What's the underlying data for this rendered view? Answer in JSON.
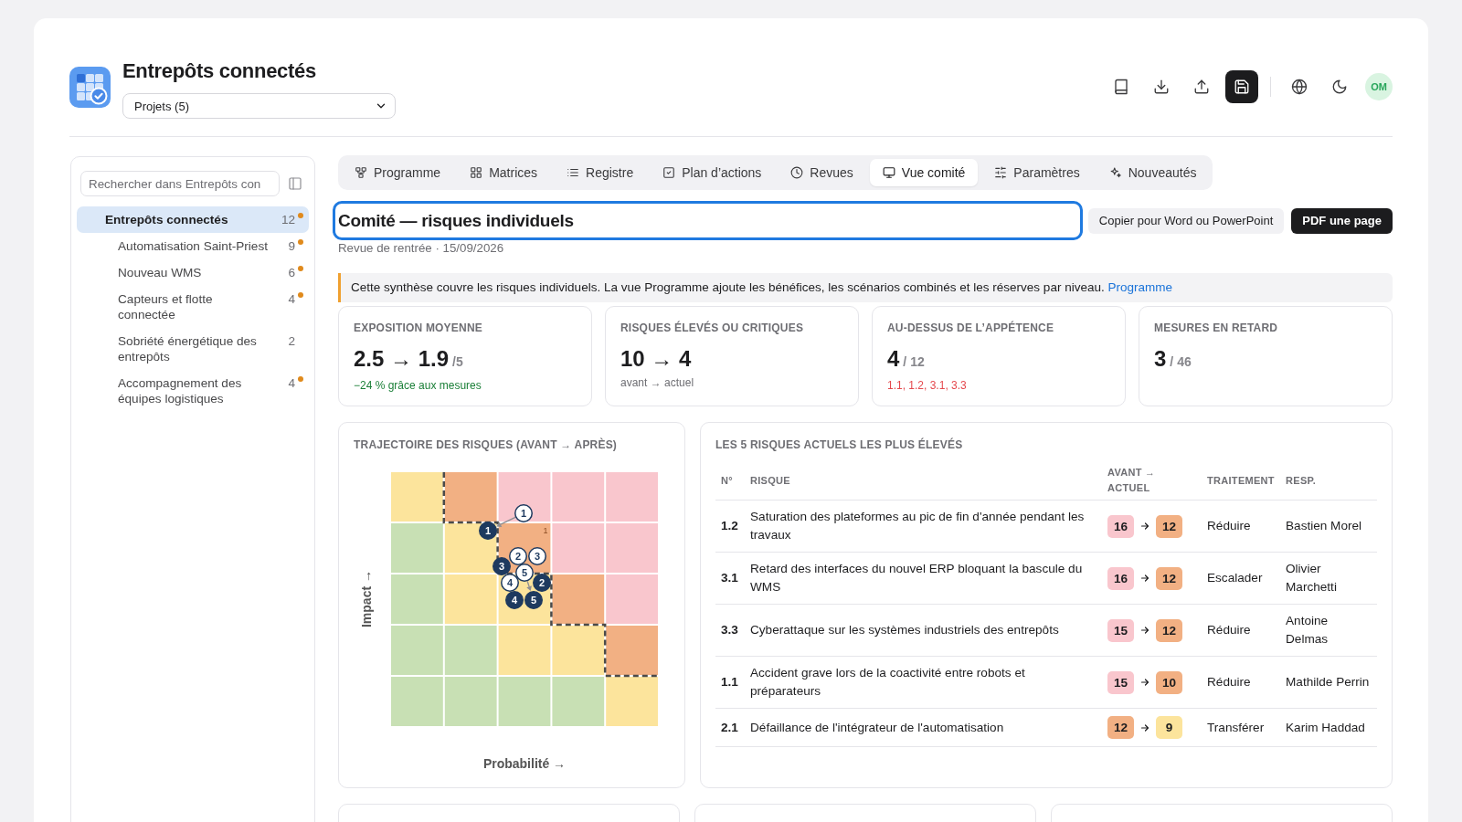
{
  "header": {
    "title": "Entrepôts connectés",
    "project_select": {
      "value": "Projets (5)"
    },
    "avatar": {
      "initials": "OM"
    }
  },
  "sidebar": {
    "search": {
      "placeholder": "Rechercher dans Entrepôts con"
    },
    "tree": [
      {
        "label": "Entrepôts connectés",
        "count": "12",
        "flagged": true,
        "selected": true,
        "children": [
          {
            "label": "Automatisation Saint-Priest",
            "count": "9",
            "flagged": true,
            "selected": false
          },
          {
            "label": "Nouveau WMS",
            "count": "6",
            "flagged": true,
            "selected": false
          },
          {
            "label": "Capteurs et flotte connectée",
            "count": "4",
            "flagged": true,
            "selected": false
          },
          {
            "label": "Sobriété énergétique des entrepôts",
            "count": "2",
            "flagged": false,
            "selected": false
          },
          {
            "label": "Accompagnement des équipes logistiques",
            "count": "4",
            "flagged": true,
            "selected": false
          }
        ]
      }
    ]
  },
  "tabs": [
    {
      "label": "Programme",
      "kind": "hierarchy",
      "selected": false
    },
    {
      "label": "Matrices",
      "kind": "grid",
      "selected": false
    },
    {
      "label": "Registre",
      "kind": "list",
      "selected": false
    },
    {
      "label": "Plan d’actions",
      "kind": "checklist",
      "selected": false
    },
    {
      "label": "Revues",
      "kind": "clock",
      "selected": false
    },
    {
      "label": "Vue comité",
      "kind": "monitor",
      "selected": true
    },
    {
      "label": "Paramètres",
      "kind": "sliders",
      "selected": false
    },
    {
      "label": "Nouveautés",
      "kind": "sparkles",
      "selected": false
    }
  ],
  "committee": {
    "title_field": {
      "value": "Comité — risques individuels"
    },
    "actions": [
      {
        "label": "Copier pour Word ou PowerPoint",
        "kind": "secondary"
      },
      {
        "label": "PDF une page",
        "kind": "primary"
      }
    ],
    "subtitle": "Revue de rentrée · 15/09/2026"
  },
  "notice": {
    "text": "Cette synthèse couvre les risques individuels. La vue Programme ajoute les bénéfices, les scénarios combinés et les réserves par niveau.",
    "link": "Programme"
  },
  "kpis": [
    {
      "title": "EXPOSITION MOYENNE",
      "value": "2.5 → 1.9",
      "unit": "/5",
      "note": {
        "text": "−24 % grâce aux mesures",
        "color": "#1a7f37"
      }
    },
    {
      "title": "RISQUES ÉLEVÉS OU CRITIQUES",
      "value": "10 → 4",
      "note": {
        "text": "avant → actuel",
        "color": "#6e6e73"
      }
    },
    {
      "title": "AU-DESSUS DE L’APPÉTENCE",
      "value": "4",
      "unit": "/ 12",
      "note": {
        "text": "1.1, 1.2, 3.1, 3.3",
        "color": "#e5484d"
      }
    },
    {
      "title": "MESURES EN RETARD",
      "value": "3",
      "unit": "/ 46"
    }
  ],
  "trajectory": {
    "title": "TRAJECTOIRE DES RISQUES (AVANT → APRÈS)",
    "y_label": "Impact →",
    "x_label": "Probabilité →",
    "rows": [
      {
        "cells": [
          {
            "color": "#fce49c"
          },
          {
            "color": "#f2b083"
          },
          {
            "color": "#f9c6cd"
          },
          {
            "color": "#f9c6cd"
          },
          {
            "color": "#f9c6cd"
          }
        ]
      },
      {
        "cells": [
          {
            "color": "#c8e0b4"
          },
          {
            "color": "#fce49c"
          },
          {
            "color": "#f2b083",
            "note": "1"
          },
          {
            "color": "#f9c6cd"
          },
          {
            "color": "#f9c6cd"
          }
        ]
      },
      {
        "cells": [
          {
            "color": "#c8e0b4"
          },
          {
            "color": "#fce49c"
          },
          {
            "color": "#fce49c"
          },
          {
            "color": "#f2b083"
          },
          {
            "color": "#f9c6cd"
          }
        ]
      },
      {
        "cells": [
          {
            "color": "#c8e0b4"
          },
          {
            "color": "#c8e0b4"
          },
          {
            "color": "#fce49c"
          },
          {
            "color": "#fce49c"
          },
          {
            "color": "#f2b083"
          }
        ]
      },
      {
        "cells": [
          {
            "color": "#c8e0b4"
          },
          {
            "color": "#c8e0b4"
          },
          {
            "color": "#c8e0b4"
          },
          {
            "color": "#c8e0b4"
          },
          {
            "color": "#fce49c"
          }
        ]
      }
    ],
    "markers": [
      {
        "label": "1",
        "kind": "before"
      },
      {
        "label": "1",
        "kind": "after"
      },
      {
        "label": "2",
        "kind": "before"
      },
      {
        "label": "2",
        "kind": "after"
      },
      {
        "label": "3",
        "kind": "before"
      },
      {
        "label": "3",
        "kind": "after"
      },
      {
        "label": "4",
        "kind": "before"
      },
      {
        "label": "4",
        "kind": "after"
      },
      {
        "label": "5",
        "kind": "before"
      },
      {
        "label": "5",
        "kind": "after"
      }
    ]
  },
  "top_risks": {
    "title": "LES 5 RISQUES ACTUELS LES PLUS ÉLEVÉS",
    "columns": [
      "N°",
      "RISQUE",
      "AVANT → ACTUEL",
      "TRAITEMENT",
      "RESP."
    ],
    "rows": [
      {
        "id": "1.2",
        "risk": "Saturation des plateformes au pic de fin d'année pendant les travaux",
        "before": {
          "score": "16",
          "color": "#f9c6cd"
        },
        "after": {
          "score": "12",
          "color": "#f2b083"
        },
        "treatment": "Réduire",
        "owner": "Bastien Morel"
      },
      {
        "id": "3.1",
        "risk": "Retard des interfaces du nouvel ERP bloquant la bascule du WMS",
        "before": {
          "score": "16",
          "color": "#f9c6cd"
        },
        "after": {
          "score": "12",
          "color": "#f2b083"
        },
        "treatment": "Escalader",
        "owner": "Olivier Marchetti"
      },
      {
        "id": "3.3",
        "risk": "Cyberattaque sur les systèmes industriels des entrepôts",
        "before": {
          "score": "15",
          "color": "#f9c6cd"
        },
        "after": {
          "score": "12",
          "color": "#f2b083"
        },
        "treatment": "Réduire",
        "owner": "Antoine Delmas"
      },
      {
        "id": "1.1",
        "risk": "Accident grave lors de la coactivité entre robots et préparateurs",
        "before": {
          "score": "15",
          "color": "#f9c6cd"
        },
        "after": {
          "score": "10",
          "color": "#f2b083"
        },
        "treatment": "Réduire",
        "owner": "Mathilde Perrin"
      },
      {
        "id": "2.1",
        "risk": "Défaillance de l'intégrateur de l'automatisation",
        "before": {
          "score": "12",
          "color": "#f2b083"
        },
        "after": {
          "score": "9",
          "color": "#fce49c"
        },
        "treatment": "Transférer",
        "owner": "Karim Haddad"
      }
    ]
  }
}
